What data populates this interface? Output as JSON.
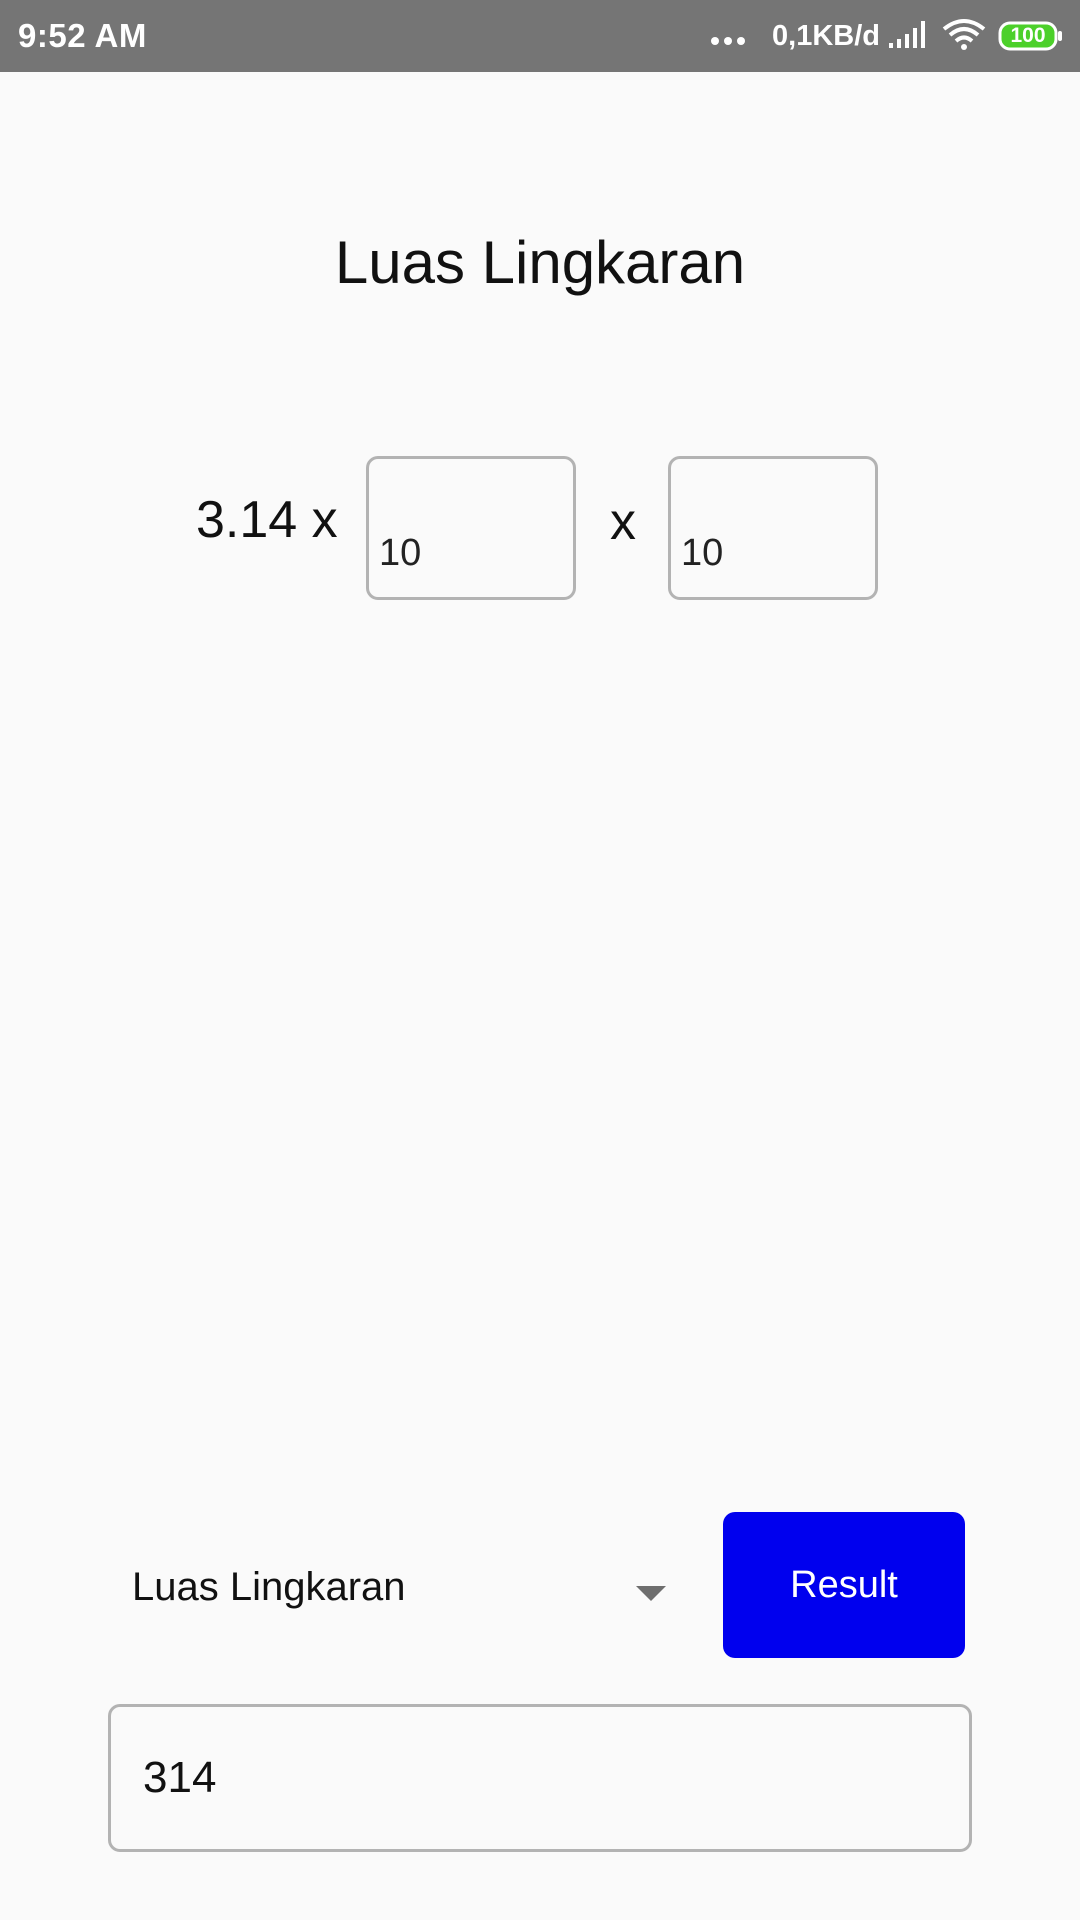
{
  "status_bar": {
    "time": "9:52 AM",
    "net_speed": "0,1KB/d",
    "battery_level": "100",
    "icons": [
      "more-dots-icon",
      "signal-icon",
      "wifi-icon",
      "battery-icon"
    ],
    "colors": {
      "background": "#757575",
      "battery": "#4cd02a"
    }
  },
  "title": "Luas Lingkaran",
  "formula": {
    "pi_label": "3.14 x",
    "radius_1": "10",
    "times_label": "x",
    "radius_2": "10"
  },
  "spinner": {
    "selected": "Luas Lingkaran",
    "icon": "dropdown-arrow-icon"
  },
  "result_button": {
    "label": "Result",
    "color": "#0000ee"
  },
  "result_value": "314"
}
